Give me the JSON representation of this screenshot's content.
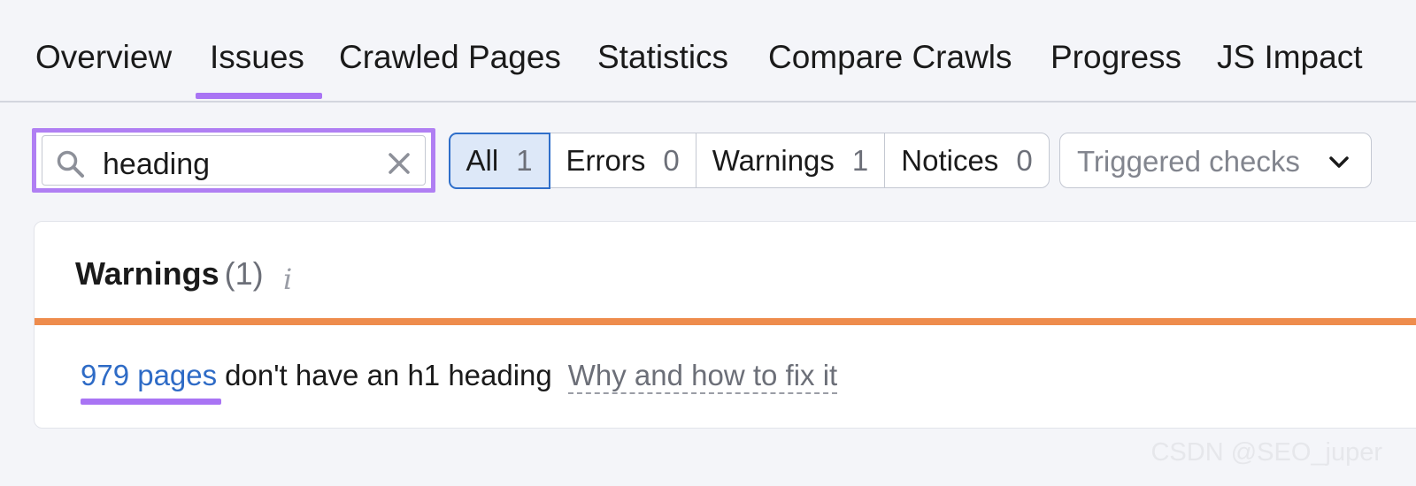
{
  "tabs": [
    {
      "label": "Overview"
    },
    {
      "label": "Issues",
      "active": true
    },
    {
      "label": "Crawled Pages"
    },
    {
      "label": "Statistics"
    },
    {
      "label": "Compare Crawls"
    },
    {
      "label": "Progress"
    },
    {
      "label": "JS Impact"
    }
  ],
  "search": {
    "value": "heading",
    "icon": "search-icon",
    "clear_icon": "close-icon"
  },
  "filters": [
    {
      "label": "All",
      "count": "1",
      "active": true
    },
    {
      "label": "Errors",
      "count": "0"
    },
    {
      "label": "Warnings",
      "count": "1"
    },
    {
      "label": "Notices",
      "count": "0"
    }
  ],
  "checks_dropdown": {
    "label": "Triggered checks",
    "icon": "chevron-down-icon"
  },
  "card": {
    "title": "Warnings",
    "count": "(1)",
    "info_icon": "i",
    "issue": {
      "link": "979 pages",
      "text": "don't have an h1 heading",
      "fix_link": "Why and how to fix it"
    }
  },
  "watermark": "CSDN @SEO_juper",
  "colors": {
    "accent_purple": "#a974f4",
    "active_blue": "#2f6fca",
    "warning_orange": "#ee8c4d",
    "link_blue": "#2e6bc6"
  }
}
